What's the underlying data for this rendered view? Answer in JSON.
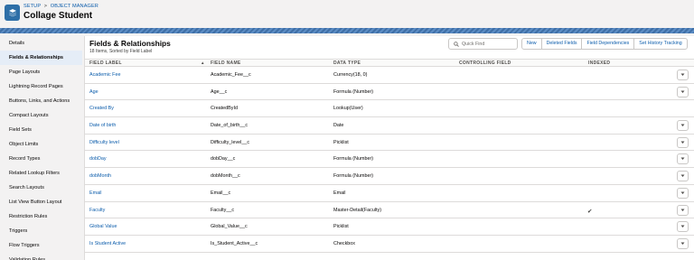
{
  "header": {
    "breadcrumb": [
      "SETUP",
      "OBJECT MANAGER"
    ],
    "breadcrumb_sep": ">",
    "title": "Collage Student",
    "icon": "layers-icon"
  },
  "sidebar": {
    "items": [
      {
        "label": "Details",
        "active": false
      },
      {
        "label": "Fields & Relationships",
        "active": true
      },
      {
        "label": "Page Layouts",
        "active": false
      },
      {
        "label": "Lightning Record Pages",
        "active": false
      },
      {
        "label": "Buttons, Links, and Actions",
        "active": false
      },
      {
        "label": "Compact Layouts",
        "active": false
      },
      {
        "label": "Field Sets",
        "active": false
      },
      {
        "label": "Object Limits",
        "active": false
      },
      {
        "label": "Record Types",
        "active": false
      },
      {
        "label": "Related Lookup Filters",
        "active": false
      },
      {
        "label": "Search Layouts",
        "active": false
      },
      {
        "label": "List View Button Layout",
        "active": false
      },
      {
        "label": "Restriction Rules",
        "active": false
      },
      {
        "label": "Triggers",
        "active": false
      },
      {
        "label": "Flow Triggers",
        "active": false
      },
      {
        "label": "Validation Rules",
        "active": false
      }
    ]
  },
  "main": {
    "title": "Fields & Relationships",
    "subtitle": "18 Items, Sorted by Field Label",
    "search_placeholder": "Quick Find",
    "buttons": [
      "New",
      "Deleted Fields",
      "Field Dependencies",
      "Set History Tracking"
    ]
  },
  "table": {
    "columns": [
      "FIELD LABEL",
      "FIELD NAME",
      "DATA TYPE",
      "CONTROLLING FIELD",
      "INDEXED"
    ],
    "sort_indicator": "▲",
    "rows": [
      {
        "label": "Academic Fee",
        "name": "Academic_Fee__c",
        "type": "Currency(18, 0)",
        "indexed": false,
        "menu": true
      },
      {
        "label": "Age",
        "name": "Age__c",
        "type": "Formula (Number)",
        "indexed": false,
        "menu": true
      },
      {
        "label": "Created By",
        "name": "CreatedById",
        "type": "Lookup(User)",
        "indexed": false,
        "menu": false
      },
      {
        "label": "Date of birth",
        "name": "Date_of_birth__c",
        "type": "Date",
        "indexed": false,
        "menu": true
      },
      {
        "label": "Difficulty level",
        "name": "Difficulty_level__c",
        "type": "Picklist",
        "indexed": false,
        "menu": true
      },
      {
        "label": "dobDay",
        "name": "dobDay__c",
        "type": "Formula (Number)",
        "indexed": false,
        "menu": true
      },
      {
        "label": "dobMonth",
        "name": "dobMonth__c",
        "type": "Formula (Number)",
        "indexed": false,
        "menu": true
      },
      {
        "label": "Email",
        "name": "Email__c",
        "type": "Email",
        "indexed": false,
        "menu": true
      },
      {
        "label": "Faculty",
        "name": "Faculty__c",
        "type": "Master-Detail(Faculty)",
        "indexed": true,
        "menu": true
      },
      {
        "label": "Global Value",
        "name": "Global_Value__c",
        "type": "Picklist",
        "indexed": false,
        "menu": true
      },
      {
        "label": "Is Student Active",
        "name": "Is_Student_Active__c",
        "type": "Checkbox",
        "indexed": false,
        "menu": true
      }
    ]
  },
  "colors": {
    "link": "#0b5cab",
    "object_icon": "#2e6fa7",
    "active_nav": "#e5edf7"
  }
}
